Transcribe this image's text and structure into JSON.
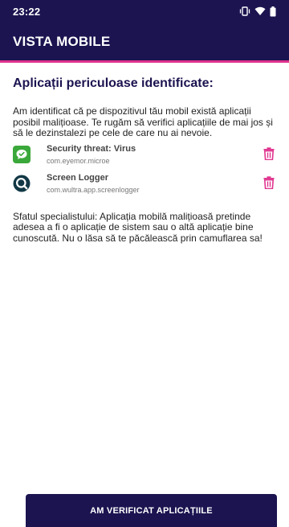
{
  "status_bar": {
    "time": "23:22",
    "icons": [
      "vibrate-icon",
      "wifi-icon",
      "battery-icon"
    ]
  },
  "app_bar": {
    "title": "VISTA MOBILE"
  },
  "main": {
    "heading": "Aplicații periculoase identificate:",
    "intro": "Am identificat că pe dispozitivul tău mobil există aplicații posibil malițioase. Te rugăm să verifici aplicațiile de mai jos și să le dezinstalezi pe cele de care nu ai nevoie.",
    "apps": [
      {
        "name": "Security threat: Virus",
        "package": "com.eyemor.microe",
        "icon": "chat-bubble-icon",
        "action_icon": "trash-icon"
      },
      {
        "name": "Screen Logger",
        "package": "com.wultra.app.screenlogger",
        "icon": "search-lens-icon",
        "action_icon": "trash-icon"
      }
    ],
    "tip": "Sfatul specialistului: Aplicația mobilă malițioasă pretinde adesea a fi o aplicație de sistem sau o altă aplicație bine cunoscută. Nu o lăsa să te păcălească prin camuflarea sa!"
  },
  "footer": {
    "button_label": "AM VERIFICAT APLICAȚIILE"
  },
  "colors": {
    "primary": "#1b1450",
    "accent": "#e0338e",
    "virus_icon_bg": "#3aa83a"
  }
}
